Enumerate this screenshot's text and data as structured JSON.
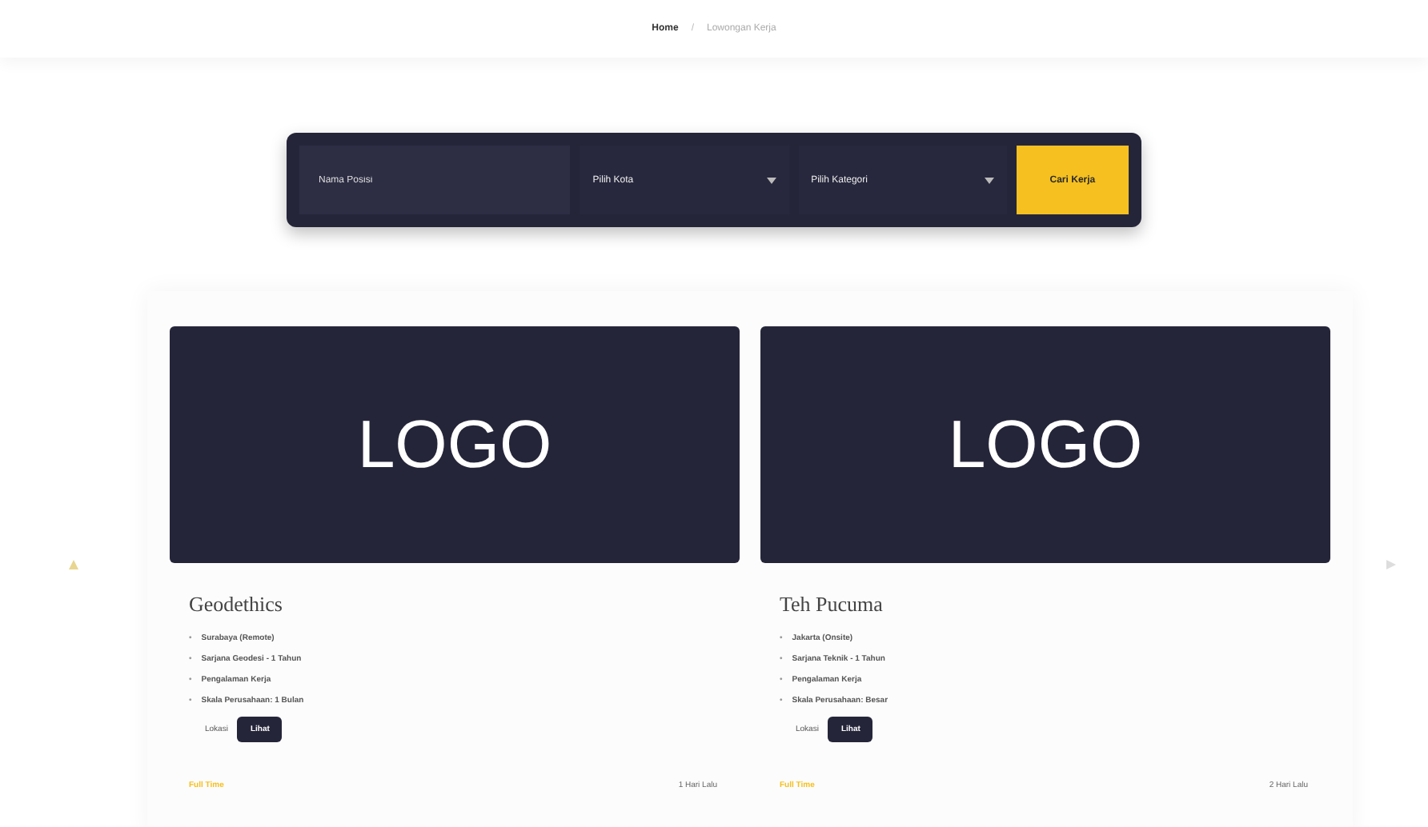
{
  "breadcrumb": [
    {
      "label": "Home",
      "selected": true
    },
    {
      "label": "Lowongan Kerja",
      "selected": false
    }
  ],
  "breadcrumb_separator": "/",
  "bullet": "•",
  "search": {
    "placeholder": "Nama Posisi",
    "selects": [
      "Pilih Kota",
      "Pilih Kategori"
    ],
    "button": "Cari Kerja"
  },
  "cards": [
    {
      "logo": "LOGO",
      "title": "Geodethics",
      "bullets": [
        "Surabaya (Remote)",
        "Sarjana Geodesi - 1 Tahun",
        "Pengalaman Kerja",
        "Skala Perusahaan: 1 Bulan"
      ],
      "extra": "Lokasi",
      "button": "Lihat",
      "status": "Full Time",
      "date": "1 Hari Lalu"
    },
    {
      "logo": "LOGO",
      "title": "Teh Pucuma",
      "bullets": [
        "Jakarta (Onsite)",
        "Sarjana Teknik - 1 Tahun",
        "Pengalaman Kerja",
        "Skala Perusahaan: Besar"
      ],
      "extra": "Lokasi",
      "button": "Lihat",
      "status": "Full Time",
      "date": "2 Hari Lalu"
    }
  ]
}
